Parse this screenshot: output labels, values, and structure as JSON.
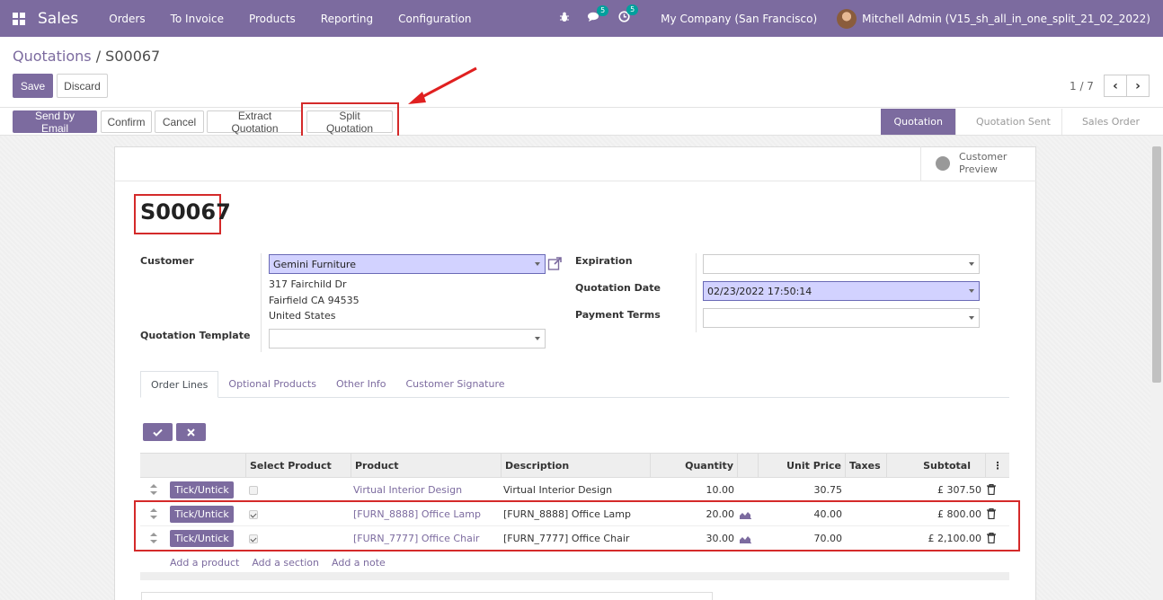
{
  "navbar": {
    "app_name": "Sales",
    "menu": [
      "Orders",
      "To Invoice",
      "Products",
      "Reporting",
      "Configuration"
    ],
    "chat_count": "5",
    "activity_count": "5",
    "company": "My Company (San Francisco)",
    "user": "Mitchell Admin (V15_sh_all_in_one_split_21_02_2022)"
  },
  "breadcrumb": {
    "parent": "Quotations",
    "separator": "/",
    "current": "S00067"
  },
  "actions": {
    "save": "Save",
    "discard": "Discard"
  },
  "pager": {
    "value": "1 / 7"
  },
  "header_buttons": {
    "send_by_email": "Send by Email",
    "confirm": "Confirm",
    "cancel": "Cancel",
    "extract": "Extract Quotation",
    "split": "Split Quotation"
  },
  "stages": [
    "Quotation",
    "Quotation Sent",
    "Sales Order"
  ],
  "preview": {
    "line1": "Customer",
    "line2": "Preview"
  },
  "record": {
    "name": "S00067",
    "customer_label": "Customer",
    "customer": "Gemini Furniture",
    "address": [
      "317 Fairchild Dr",
      "Fairfield CA 94535",
      "United States"
    ],
    "template_label": "Quotation Template",
    "template": "",
    "expiration_label": "Expiration",
    "expiration": "",
    "date_label": "Quotation Date",
    "date": "02/23/2022 17:50:14",
    "terms_label": "Payment Terms",
    "terms": ""
  },
  "tabs": [
    "Order Lines",
    "Optional Products",
    "Other Info",
    "Customer Signature"
  ],
  "table": {
    "headers": {
      "select": "Select Product",
      "product": "Product",
      "description": "Description",
      "quantity": "Quantity",
      "unit_price": "Unit Price",
      "taxes": "Taxes",
      "subtotal": "Subtotal"
    },
    "tick_label": "Tick/Untick",
    "rows": [
      {
        "product": "Virtual Interior Design",
        "description": "Virtual Interior Design",
        "quantity": "10.00",
        "unit_price": "30.75",
        "subtotal": "£ 307.50"
      },
      {
        "product": "[FURN_8888] Office Lamp",
        "description": "[FURN_8888] Office Lamp",
        "quantity": "20.00",
        "unit_price": "40.00",
        "subtotal": "£ 800.00"
      },
      {
        "product": "[FURN_7777] Office Chair",
        "description": "[FURN_7777] Office Chair",
        "quantity": "30.00",
        "unit_price": "70.00",
        "subtotal": "£ 2,100.00"
      }
    ],
    "add_product": "Add a product",
    "add_section": "Add a section",
    "add_note": "Add a note"
  }
}
